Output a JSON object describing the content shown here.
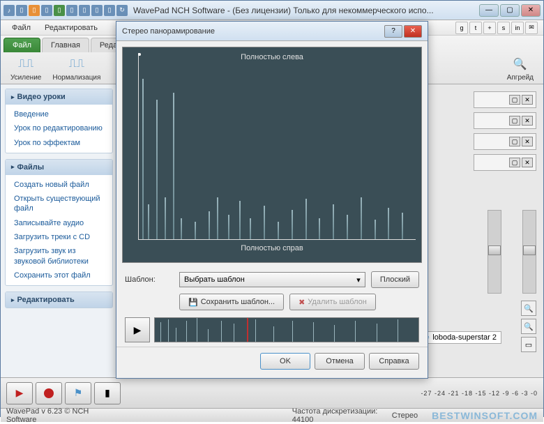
{
  "window": {
    "title": "WavePad NCH Software - (Без лицензии) Только для некоммерческого испо..."
  },
  "menu": {
    "file": "Файл",
    "edit": "Редактировать"
  },
  "social_icons": [
    "g",
    "t",
    "+",
    "s",
    "in",
    "✉"
  ],
  "ribbon": {
    "tabs": {
      "file": "Файл",
      "main": "Главная",
      "edit": "Реда"
    },
    "amplify": "Усиление",
    "normalize": "Нормализация",
    "upgrade": "Апгрейд"
  },
  "sidebar": {
    "video_lessons": {
      "title": "Видео уроки",
      "links": [
        "Введение",
        "Урок по редактированию",
        "Урок по эффектам"
      ]
    },
    "files": {
      "title": "Файлы",
      "links": [
        "Создать новый файл",
        "Открыть существующий файл",
        "Записывайте аудио",
        "Загрузить треки с CD",
        "Загрузить звук из звуковой библиотеки",
        "Сохранить этот файл"
      ]
    },
    "edit": {
      "title": "Редактировать"
    }
  },
  "file_tab": "loboda-superstar 2",
  "transport": {
    "db_scale": "-27 -24 -21 -18 -15 -12 -9 -6 -3 -0"
  },
  "statusbar": {
    "version": "WavePad v 6.23 © NCH Software",
    "sample_rate": "Частота дискретизации: 44100",
    "stereo": "Стерео",
    "watermark": "BESTWINSOFT.COM"
  },
  "dialog": {
    "title": "Стерео панорамирование",
    "full_left": "Полностью слева",
    "full_right": "Полностью справ",
    "template_label": "Шаблон:",
    "template_select": "Выбрать шаблон",
    "flat": "Плоский",
    "save_template": "Сохранить шаблон...",
    "delete_template": "Удалить шаблон",
    "ok": "OK",
    "cancel": "Отмена",
    "help": "Справка"
  }
}
